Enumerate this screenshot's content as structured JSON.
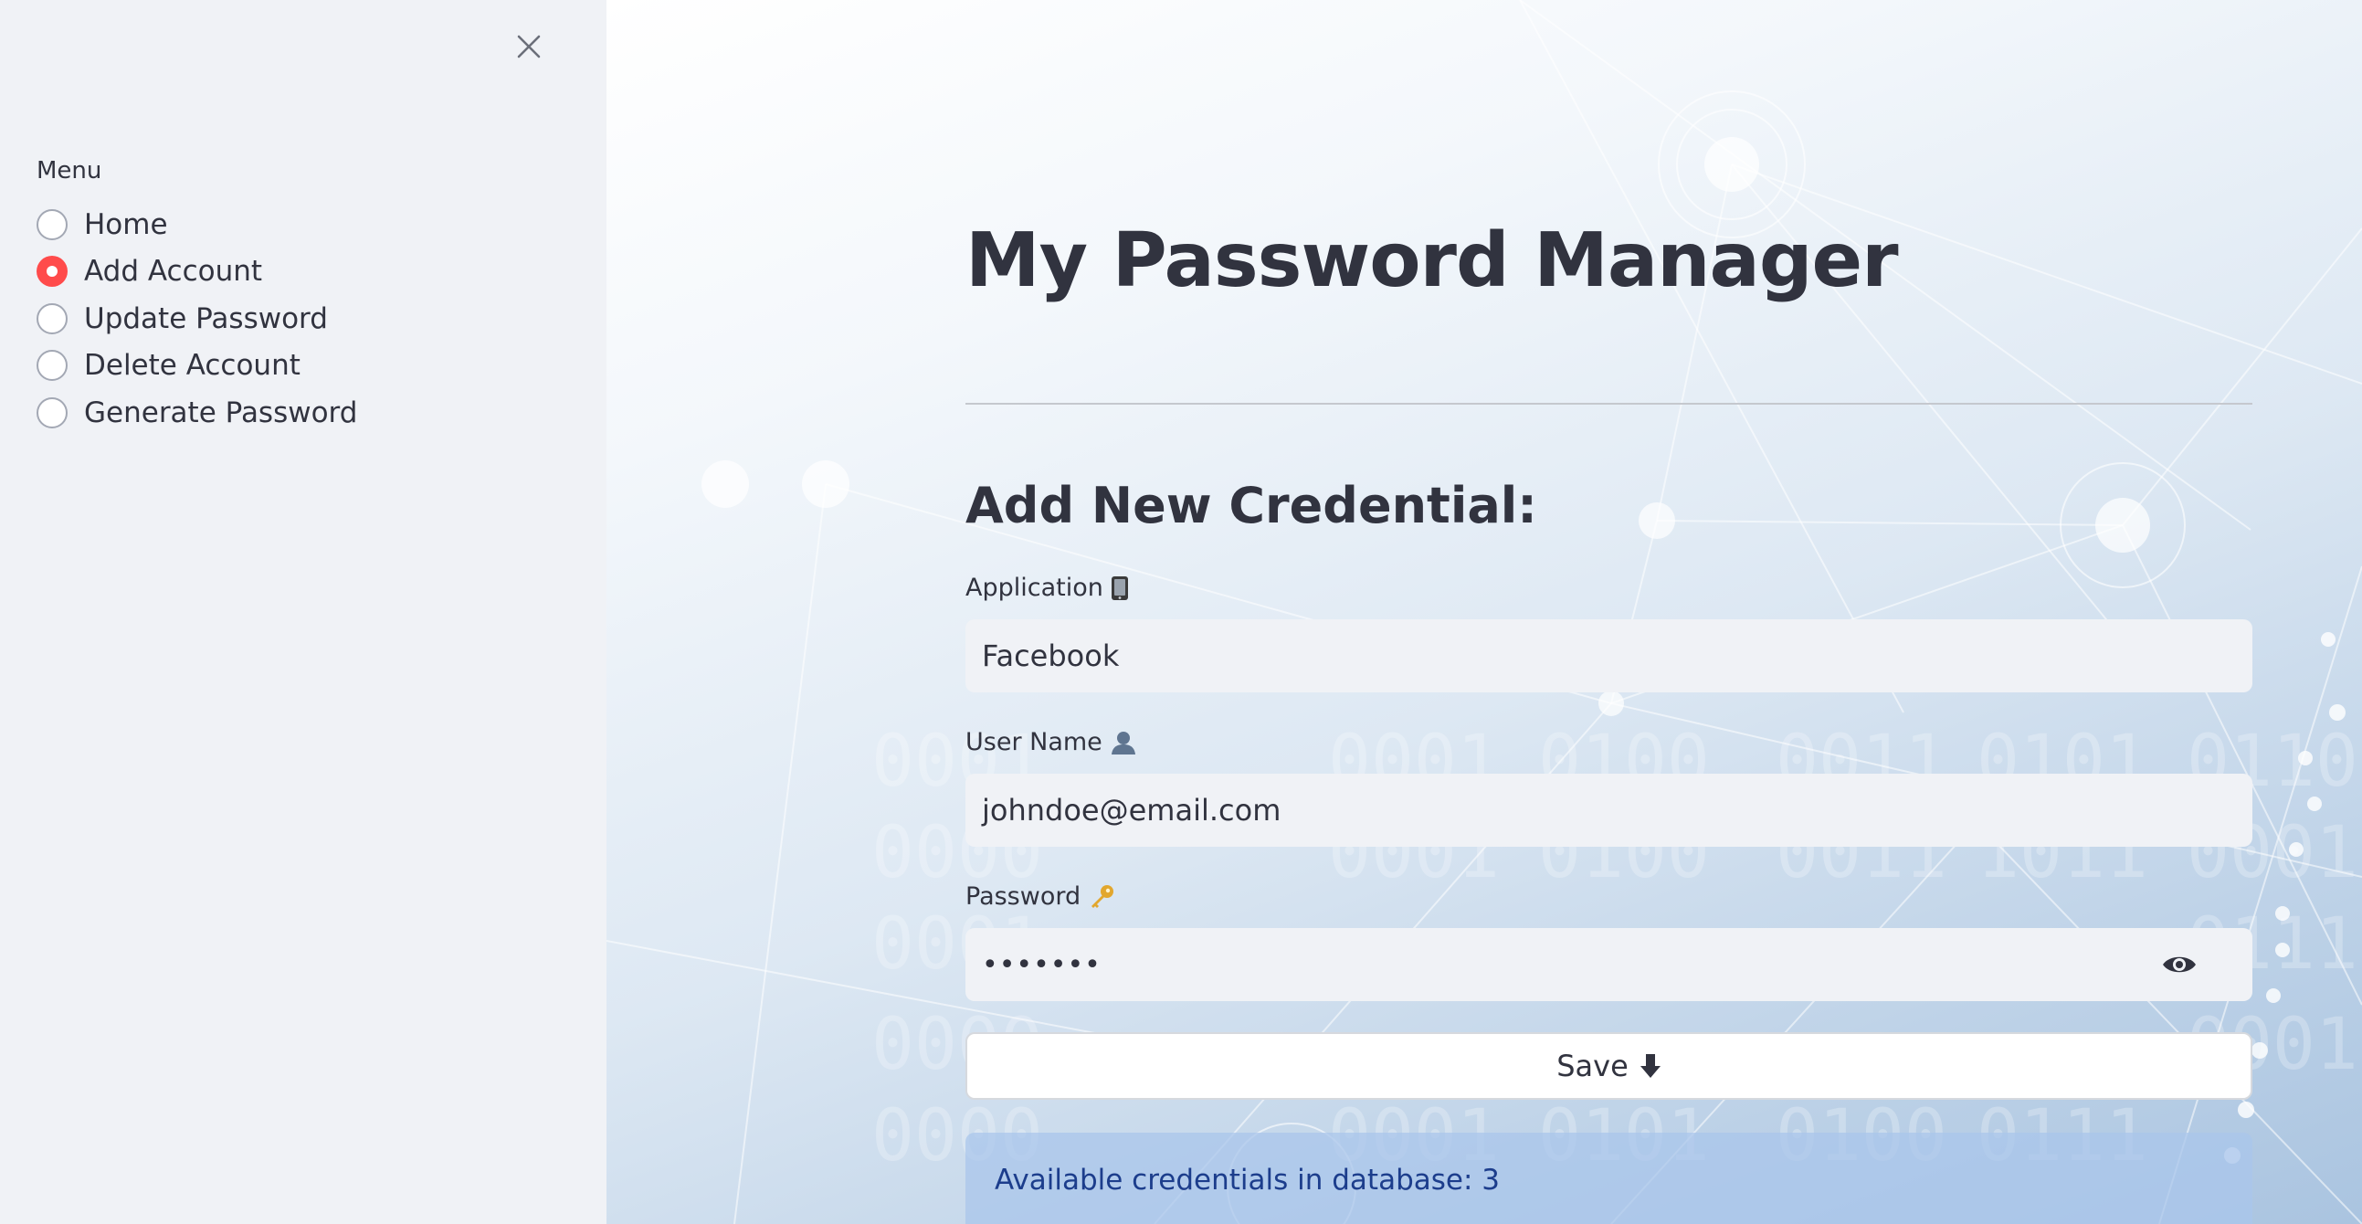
{
  "sidebar": {
    "menu_label": "Menu",
    "items": [
      {
        "label": "Home",
        "checked": false
      },
      {
        "label": "Add Account",
        "checked": true
      },
      {
        "label": "Update Password",
        "checked": false
      },
      {
        "label": "Delete Account",
        "checked": false
      },
      {
        "label": "Generate Password",
        "checked": false
      }
    ]
  },
  "main": {
    "title": "My Password Manager",
    "section_title": "Add New Credential:",
    "fields": {
      "application": {
        "label": "Application",
        "icon": "mobile-phone-icon",
        "value": "Facebook"
      },
      "username": {
        "label": "User Name",
        "icon": "person-silhouette-icon",
        "value": "johndoe@email.com"
      },
      "password": {
        "label": "Password",
        "icon": "key-icon",
        "value_masked": "•••••••",
        "reveal_icon": "eye-icon"
      }
    },
    "save_button": {
      "label": "Save",
      "icon": "down-arrow-icon"
    },
    "info_text": "Available credentials in database: 3"
  },
  "colors": {
    "sidebar_bg": "#f0f2f6",
    "accent": "#ff4b4b",
    "input_bg": "#f0f2f6",
    "info_text": "#1c3d8c"
  }
}
